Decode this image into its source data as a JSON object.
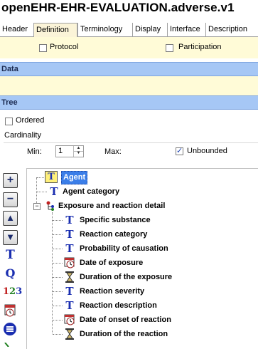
{
  "title": "openEHR-EHR-EVALUATION.adverse.v1",
  "tabs": [
    "Header",
    "Definition",
    "Terminology",
    "Display",
    "Interface",
    "Description"
  ],
  "active_tab": "Definition",
  "checkboxes": {
    "protocol": "Protocol",
    "participation": "Participation"
  },
  "data_label": "Data",
  "tree_label": "Tree",
  "ordered_label": "Ordered",
  "cardinality": {
    "label": "Cardinality",
    "min_label": "Min:",
    "min_value": "1",
    "max_label": "Max:",
    "unbounded_label": "Unbounded",
    "unbounded_checked": true
  },
  "toolbar": [
    "plus-icon",
    "minus-icon",
    "arrow-up-icon",
    "arrow-down-icon",
    "text-type-icon",
    "quantity-type-icon",
    "count-type-icon",
    "date-type-icon",
    "ordinal-type-icon"
  ],
  "tree": {
    "selected": "Agent",
    "items": [
      {
        "label": "Agent",
        "type": "text",
        "level": 1
      },
      {
        "label": "Agent category",
        "type": "text",
        "level": 1
      },
      {
        "label": "Exposure and reaction detail",
        "type": "cluster",
        "level": 1
      },
      {
        "label": "Specific substance",
        "type": "text",
        "level": 2
      },
      {
        "label": "Reaction category",
        "type": "text",
        "level": 2
      },
      {
        "label": "Probability of causation",
        "type": "text",
        "level": 2
      },
      {
        "label": "Date of exposure",
        "type": "datetime",
        "level": 2
      },
      {
        "label": "Duration of the exposure",
        "type": "duration",
        "level": 2
      },
      {
        "label": "Reaction severity",
        "type": "text",
        "level": 2
      },
      {
        "label": "Reaction description",
        "type": "text",
        "level": 2
      },
      {
        "label": "Date of onset of reaction",
        "type": "datetime",
        "level": 2
      },
      {
        "label": "Duration of the reaction",
        "type": "duration",
        "level": 2
      }
    ]
  },
  "colors": {
    "band_blue": "#a6c7f5",
    "pale_yellow": "#fffbd7",
    "selection": "#3b7ee8",
    "icon_blue": "#1a2eb0"
  }
}
